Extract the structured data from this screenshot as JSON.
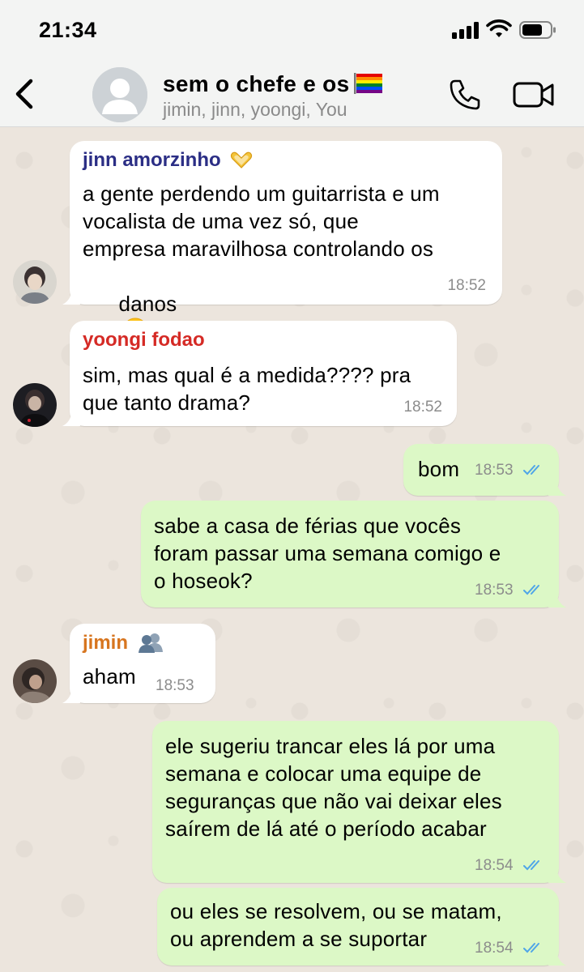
{
  "status_bar": {
    "time": "21:34"
  },
  "header": {
    "group_name": "sem o chefe e os",
    "members": "jimin, jinn, yoongi, You"
  },
  "colors": {
    "incoming_bubble": "#ffffff",
    "outgoing_bubble": "#dcf8c6",
    "read_ticks": "#4fa5e8",
    "sender_jinn": "#2b2e85",
    "sender_yoongi": "#d52a25",
    "sender_jimin": "#d7751f"
  },
  "messages": [
    {
      "direction": "incoming",
      "sender": "jinn amorzinho",
      "sender_icon": "heart-hands-icon",
      "lines": [
        "a gente perdendo um guitarrista e um",
        "vocalista de uma vez só, que",
        "empresa maravilhosa controlando os",
        "danos"
      ],
      "emoji": "heart-eyes-emoji",
      "time": "18:52"
    },
    {
      "direction": "incoming",
      "sender": "yoongi fodao",
      "lines": [
        "sim, mas qual é a medida???? pra",
        "que tanto drama?"
      ],
      "time": "18:52"
    },
    {
      "direction": "outgoing",
      "lines": [
        "bom"
      ],
      "time": "18:53",
      "status": "read"
    },
    {
      "direction": "outgoing",
      "lines": [
        "sabe a casa de férias que vocês",
        "foram passar uma semana comigo e",
        "o hoseok?"
      ],
      "time": "18:53",
      "status": "read"
    },
    {
      "direction": "incoming",
      "sender": "jimin",
      "sender_icon": "busts-icon",
      "lines": [
        "aham"
      ],
      "time": "18:53"
    },
    {
      "direction": "outgoing",
      "lines": [
        "ele sugeriu trancar eles lá por uma",
        "semana e colocar uma equipe de",
        "seguranças que não vai deixar eles",
        "saírem de lá até o período acabar"
      ],
      "time": "18:54",
      "status": "read"
    },
    {
      "direction": "outgoing",
      "lines": [
        "ou eles se resolvem, ou se matam,",
        "ou aprendem a se suportar"
      ],
      "time": "18:54",
      "status": "read"
    }
  ]
}
